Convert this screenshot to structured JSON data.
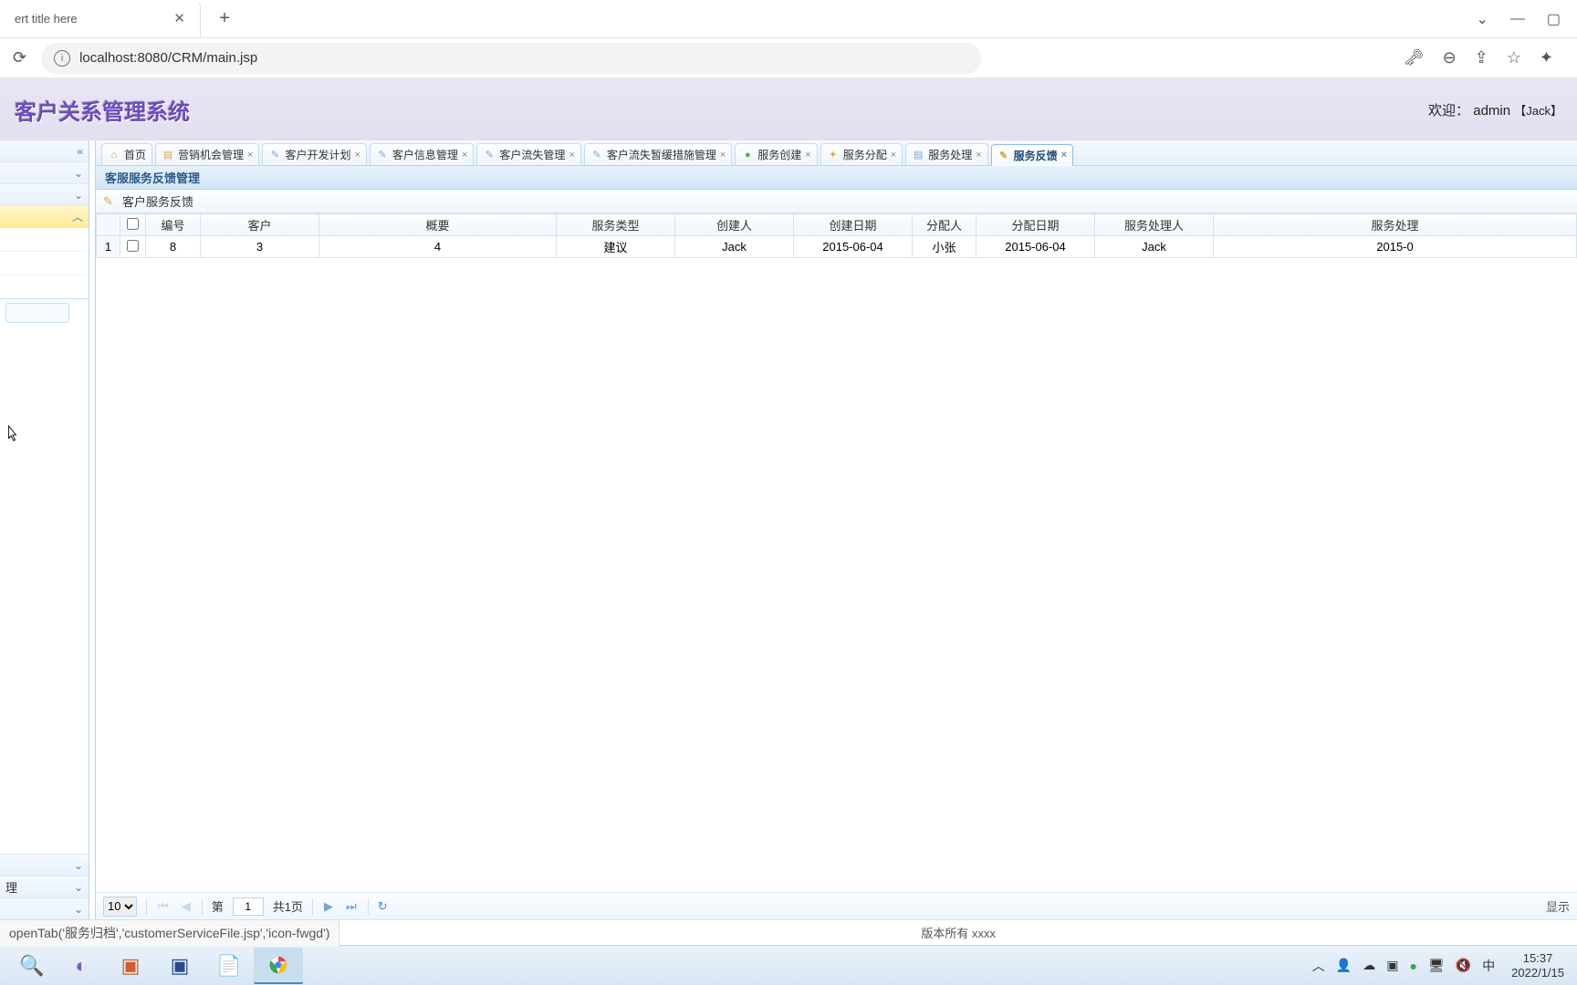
{
  "browser": {
    "tab_title": "ert title here",
    "url": "localhost:8080/CRM/main.jsp",
    "win_min": "—",
    "win_max": "▢",
    "chevron": "⌄"
  },
  "header": {
    "app_title": "客户关系管理系统",
    "welcome_prefix": "欢迎：",
    "welcome_user": "admin",
    "welcome_role": "【Jack】"
  },
  "sidebar": {
    "collapse_label": "«",
    "expand_down": "⌄",
    "expand_up": "︿",
    "bottom_label": "理"
  },
  "tabs": [
    {
      "label": "首页",
      "closable": false,
      "icon": "home"
    },
    {
      "label": "营销机会管理",
      "closable": true,
      "icon": "doc"
    },
    {
      "label": "客户开发计划",
      "closable": true,
      "icon": "edit"
    },
    {
      "label": "客户信息管理",
      "closable": true,
      "icon": "edit"
    },
    {
      "label": "客户流失管理",
      "closable": true,
      "icon": "edit"
    },
    {
      "label": "客户流失暂缓措施管理",
      "closable": true,
      "icon": "edit"
    },
    {
      "label": "服务创建",
      "closable": true,
      "icon": "add"
    },
    {
      "label": "服务分配",
      "closable": true,
      "icon": "dist"
    },
    {
      "label": "服务处理",
      "closable": true,
      "icon": "proc"
    },
    {
      "label": "服务反馈",
      "closable": true,
      "icon": "fb",
      "active": true
    }
  ],
  "panel": {
    "title": "客服服务反馈管理",
    "toolbar_label": "客户服务反馈"
  },
  "grid": {
    "columns": [
      "编号",
      "客户",
      "概要",
      "服务类型",
      "创建人",
      "创建日期",
      "分配人",
      "分配日期",
      "服务处理人",
      "服务处理"
    ],
    "rows": [
      {
        "num": "1",
        "id": "8",
        "customer": "3",
        "summary": "4",
        "svc_type": "建议",
        "creator": "Jack",
        "create_date": "2015-06-04",
        "assignee": "小张",
        "assign_date": "2015-06-04",
        "handler": "Jack",
        "handle_date": "2015-0"
      }
    ]
  },
  "pagination": {
    "page_size": "10",
    "page_prefix": "第",
    "page_value": "1",
    "page_total": "共1页",
    "info": "显示"
  },
  "status": {
    "link_preview": "openTab('服务归档','customerServiceFile.jsp','icon-fwgd')",
    "footer": "版本所有 xxxx"
  },
  "taskbar": {
    "time": "15:37",
    "date": "2022/1/15",
    "ime": "中"
  }
}
